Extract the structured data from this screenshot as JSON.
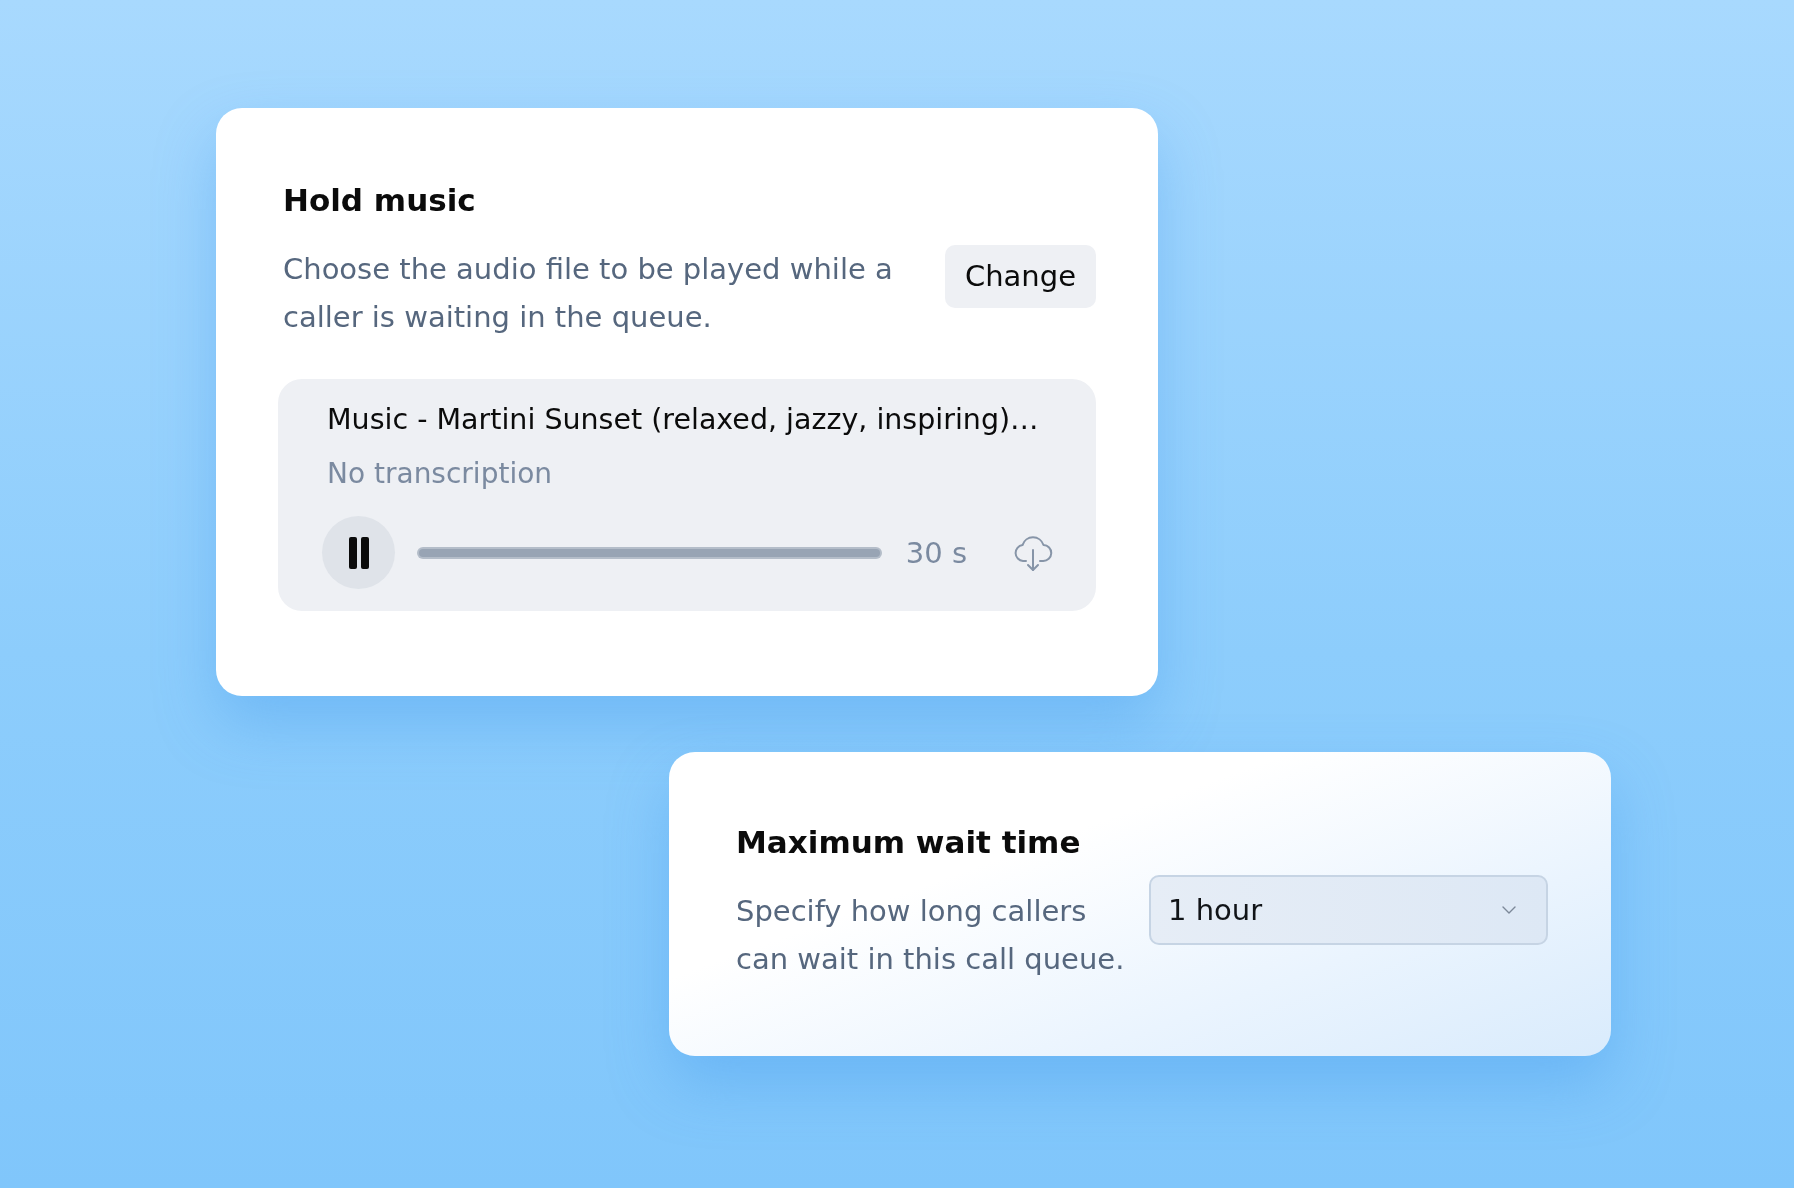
{
  "hold_music": {
    "title": "Hold music",
    "description": "Choose the audio file to be played while a caller is waiting in the queue.",
    "change_button": "Change",
    "player": {
      "track_title": "Music - Martini Sunset (relaxed, jazzy, inspiring)…",
      "transcription": "No transcription",
      "playing": true,
      "level": 1,
      "duration": "30 s"
    }
  },
  "max_wait_time": {
    "title": "Maximum wait time",
    "description": "Specify how long callers can wait in this call queue.",
    "select": {
      "value": "1 hour"
    }
  }
}
